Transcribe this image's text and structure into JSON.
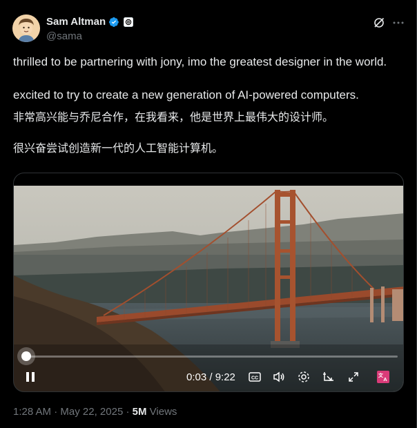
{
  "author": {
    "display_name": "Sam Altman",
    "handle": "@sama",
    "verified": true,
    "verified_color": "#1d9bf0",
    "affiliation_icon": "openai-badge-icon"
  },
  "tweet": {
    "lines": [
      "thrilled to be partnering with jony, imo the greatest designer in the world.",
      "excited to try to create a new generation of AI-powered computers.",
      "非常高兴能与乔尼合作，在我看来，他是世界上最伟大的设计师。",
      "很兴奋尝试创造新一代的人工智能计算机。"
    ]
  },
  "video": {
    "current_time": "0:03",
    "duration": "9:22",
    "time_display": "0:03 / 9:22",
    "progress_fraction": 0.005,
    "scene_icon": "golden-gate-bridge-video-frame"
  },
  "meta": {
    "time": "1:28 AM",
    "separator": "·",
    "date": "May 22, 2025",
    "views_count": "5M",
    "views_label": "Views"
  },
  "colors": {
    "background": "#000000",
    "text": "#e7e9ea",
    "secondary": "#71767b",
    "border": "#2f3336",
    "accent": "#1d9bf0",
    "translate_badge": "#d93b78"
  }
}
